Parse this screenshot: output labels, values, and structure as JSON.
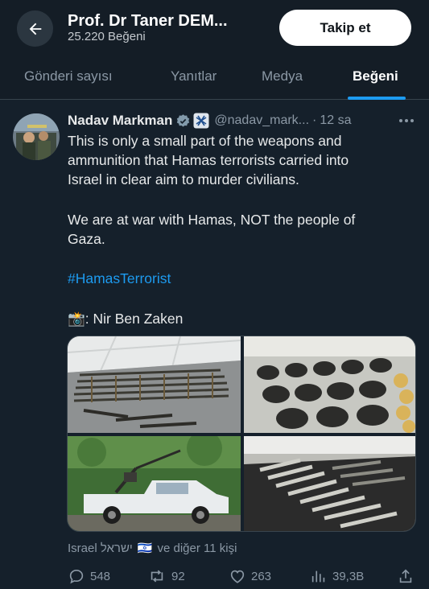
{
  "header": {
    "profile_name": "Prof. Dr Taner DEM...",
    "likes_count": "25.220 Beğeni",
    "follow_label": "Takip et"
  },
  "tabs": [
    {
      "label": "Gönderi sayısı",
      "active": false
    },
    {
      "label": "Yanıtlar",
      "active": false
    },
    {
      "label": "Medya",
      "active": false
    },
    {
      "label": "Beğeni",
      "active": true
    }
  ],
  "tweet": {
    "author_name": "Nadav Markman",
    "handle": "@nadav_mark...",
    "separator": "·",
    "time": "12 sa",
    "text_line1": "This is only a small part of the weapons and",
    "text_line2": "ammunition that Hamas terrorists carried into",
    "text_line3": "Israel in clear aim to murder civilians.",
    "text_line4": "We are at war with Hamas, NOT the people of",
    "text_line5": "Gaza.",
    "hashtag": "#HamasTerrorist",
    "camera_emoji": "📸",
    "credit": ": Nir Ben Zaken",
    "liked_by_place": "Israel ישראל",
    "liked_by_flag": "🇮🇱",
    "liked_by_rest": "ve diğer 11 kişi"
  },
  "actions": {
    "replies": "548",
    "reposts": "92",
    "likes": "263",
    "views": "39,3B"
  },
  "icons": [
    "back-arrow-icon",
    "verified-badge-icon",
    "affiliation-badge-icon",
    "more-icon",
    "reply-icon",
    "repost-icon",
    "like-icon",
    "views-icon",
    "share-icon"
  ],
  "colors": {
    "background": "#15202b",
    "accent": "#1d9bf0",
    "muted": "#8b98a5"
  }
}
